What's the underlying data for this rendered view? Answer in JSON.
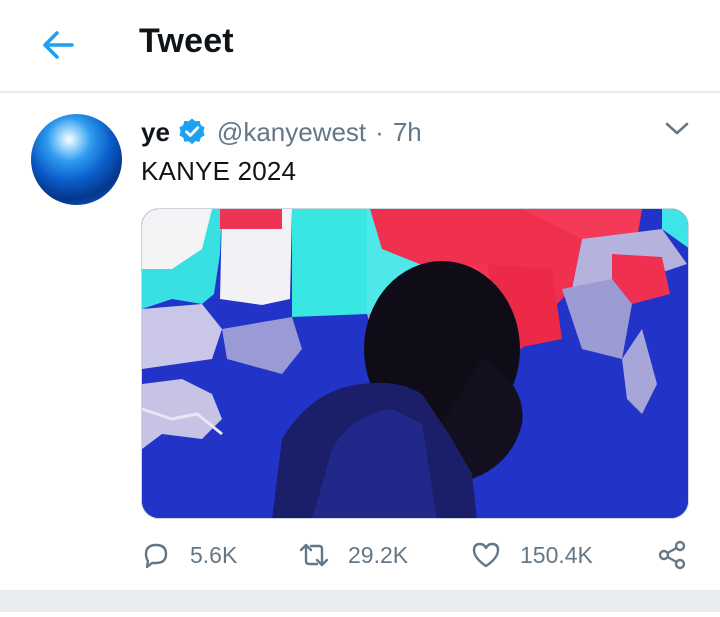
{
  "header": {
    "title": "Tweet"
  },
  "tweet": {
    "display_name": "ye",
    "handle": "@kanyewest",
    "separator": "·",
    "time": "7h",
    "text": "KANYE 2024"
  },
  "actions": {
    "replies": "5.6K",
    "retweets": "29.2K",
    "likes": "150.4K"
  },
  "colors": {
    "accent": "#1da1f2",
    "muted": "#657786",
    "divider": "#e6ecf0"
  },
  "icons": [
    "back-arrow-icon",
    "verified-badge-icon",
    "chevron-down-icon",
    "reply-icon",
    "retweet-icon",
    "like-icon",
    "share-icon"
  ]
}
